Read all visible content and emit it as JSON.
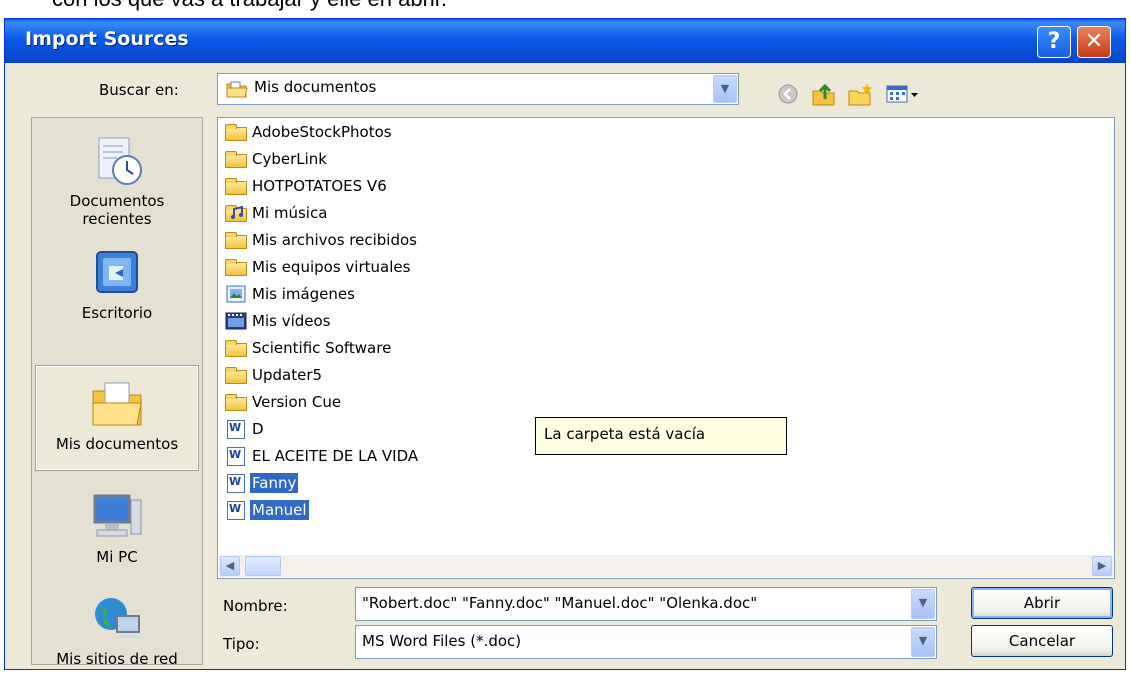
{
  "background_caption": "con los que vas a trabajar y elle en abrir.",
  "dialog": {
    "title": "Import Sources",
    "help_symbol": "?",
    "close_symbol": "✕"
  },
  "toolbar": {
    "look_in_label": "Buscar en:",
    "look_in_value": "Mis documentos",
    "icons": [
      "back-icon",
      "up-folder-icon",
      "new-folder-icon",
      "view-menu-icon"
    ]
  },
  "places": [
    {
      "line1": "Documentos",
      "line2": "recientes",
      "icon": "recent-documents-icon"
    },
    {
      "line1": "Escritorio",
      "line2": "",
      "icon": "desktop-icon"
    },
    {
      "line1": "Mis documentos",
      "line2": "",
      "icon": "my-documents-icon",
      "selected": true
    },
    {
      "line1": "Mi PC",
      "line2": "",
      "icon": "my-computer-icon"
    },
    {
      "line1": "Mis sitios de red",
      "line2": "",
      "icon": "network-places-icon"
    }
  ],
  "files": [
    {
      "name": "AdobeStockPhotos",
      "type": "folder"
    },
    {
      "name": "CyberLink",
      "type": "folder"
    },
    {
      "name": "HOTPOTATOES V6",
      "type": "folder"
    },
    {
      "name": "Mi música",
      "type": "music-folder"
    },
    {
      "name": "Mis archivos recibidos",
      "type": "folder"
    },
    {
      "name": "Mis equipos virtuales",
      "type": "folder"
    },
    {
      "name": "Mis imágenes",
      "type": "pictures-folder"
    },
    {
      "name": "Mis vídeos",
      "type": "videos-folder"
    },
    {
      "name": "Scientific Software",
      "type": "folder"
    },
    {
      "name": "Updater5",
      "type": "folder"
    },
    {
      "name": "Version Cue",
      "type": "folder"
    },
    {
      "name": "D",
      "type": "word-doc"
    },
    {
      "name": "EL ACEITE DE LA VIDA",
      "type": "word-doc"
    },
    {
      "name": "Fanny",
      "type": "word-doc",
      "selected": true
    },
    {
      "name": "Manuel",
      "type": "word-doc",
      "selected": true
    }
  ],
  "tooltip": "La carpeta está vacía",
  "filename": {
    "label": "Nombre:",
    "value": "\"Robert.doc\" \"Fanny.doc\" \"Manuel.doc\" \"Olenka.doc\""
  },
  "filetype": {
    "label": "Tipo:",
    "value": "MS Word Files (*.doc)"
  },
  "buttons": {
    "open": "Abrir",
    "cancel": "Cancelar"
  },
  "colors": {
    "titlebar": "#0A5AE8",
    "selection": "#316AC5",
    "dialog_face": "#ECE9D8",
    "tooltip_bg": "#FFFFE1"
  }
}
